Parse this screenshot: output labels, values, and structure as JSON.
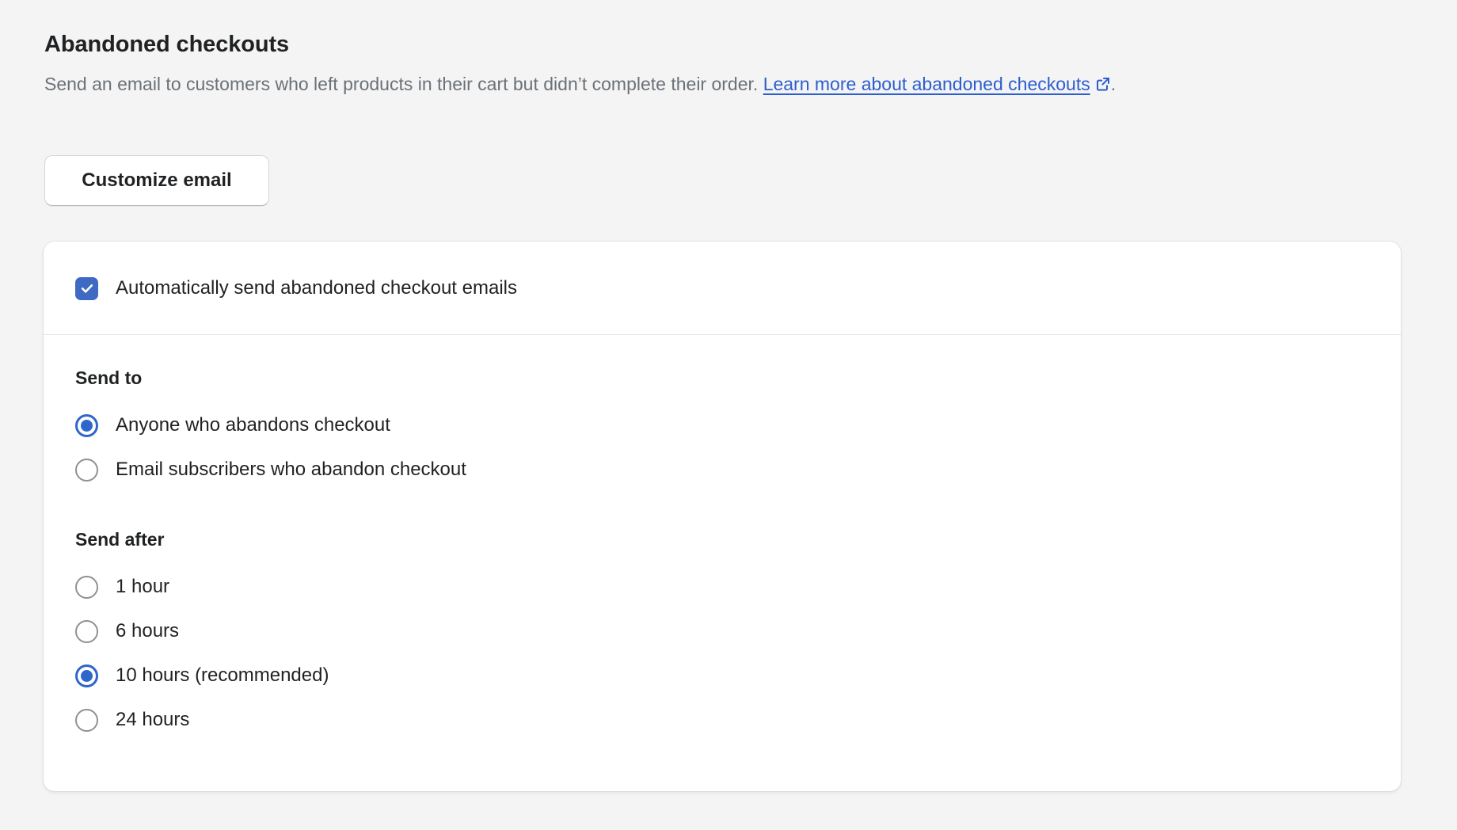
{
  "section": {
    "title": "Abandoned checkouts",
    "description_before_link": "Send an email to customers who left products in their cart but didn’t complete their order. ",
    "link_text": "Learn more about abandoned checkouts",
    "link_icon": "external-link-icon",
    "description_after_link": "."
  },
  "customize_button": {
    "label": "Customize email"
  },
  "card": {
    "auto_send": {
      "label": "Automatically send abandoned checkout emails",
      "checked": true,
      "icon": "checkmark-icon"
    },
    "send_to": {
      "heading": "Send to",
      "options": [
        {
          "label": "Anyone who abandons checkout",
          "selected": true
        },
        {
          "label": "Email subscribers who abandon checkout",
          "selected": false
        }
      ]
    },
    "send_after": {
      "heading": "Send after",
      "options": [
        {
          "label": "1 hour",
          "selected": false
        },
        {
          "label": "6 hours",
          "selected": false
        },
        {
          "label": "10 hours (recommended)",
          "selected": true
        },
        {
          "label": "24 hours",
          "selected": false
        }
      ]
    }
  },
  "colors": {
    "page_background": "#f4f4f4",
    "card_background": "#ffffff",
    "accent_blue": "#2f66cc",
    "checkbox_blue": "#3f6ac4",
    "link_blue": "#2c5ecf",
    "text_primary": "#1f2123",
    "text_secondary": "#6b7177",
    "radio_unselected": "#8d9196",
    "divider": "#e4e5e7"
  }
}
